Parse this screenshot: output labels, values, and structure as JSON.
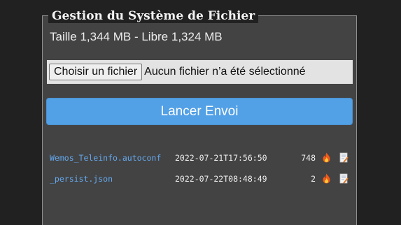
{
  "panel": {
    "title": "Gestion du Système de Fichier",
    "size_info": "Taille 1,344 MB - Libre 1,324 MB"
  },
  "upload": {
    "choose_label": "Choisir un fichier",
    "no_file_label": "Aucun fichier n’a été sélectionné",
    "send_label": "Lancer Envoi"
  },
  "files": [
    {
      "name": "Wemos_Teleinfo.autoconf",
      "date": "2022-07-21T17:56:50",
      "size": "748",
      "delete_icon": "fire-icon",
      "edit_icon": "edit-icon"
    },
    {
      "name": "_persist.json",
      "date": "2022-07-22T08:48:49",
      "size": "2",
      "delete_icon": "fire-icon",
      "edit_icon": "edit-icon"
    }
  ],
  "colors": {
    "background": "#212121",
    "panel": "#434343",
    "accent": "#52a0e6",
    "link": "#64a8ee"
  }
}
